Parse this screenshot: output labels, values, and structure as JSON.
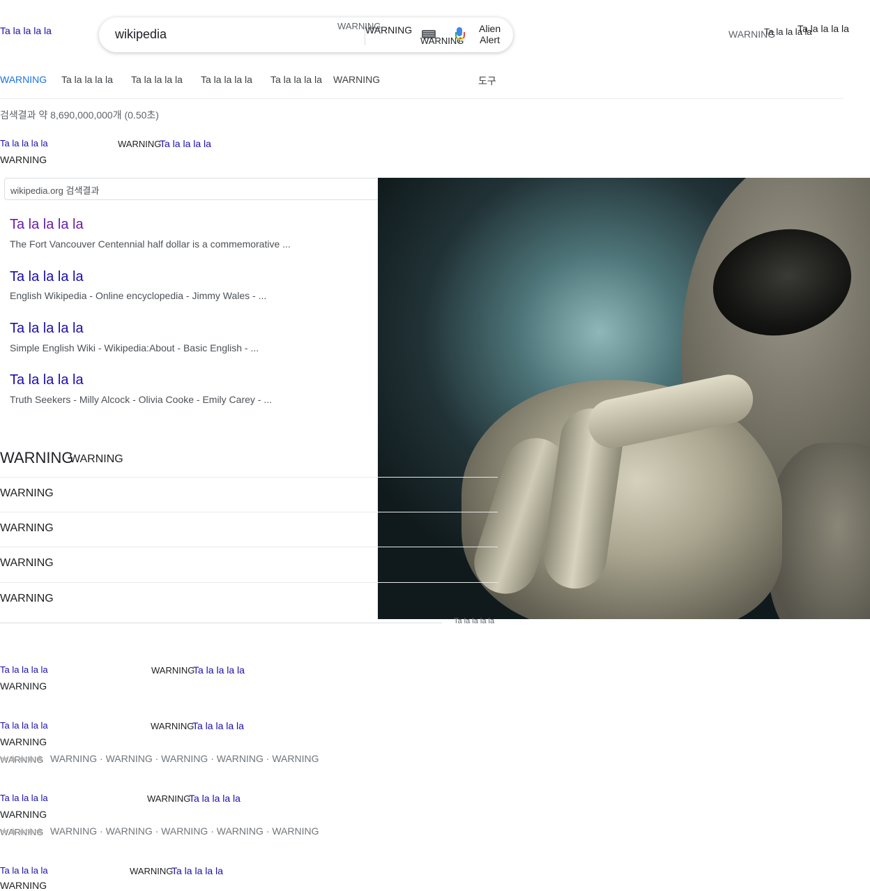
{
  "header": {
    "logo_text": "Ta la la la la",
    "search_value": "wikipedia",
    "box_warning_1": "WARNING",
    "box_warning_2": "WARNING",
    "box_warning_3": "WARNING",
    "alien_alert_line1": "Alien",
    "alien_alert_line2": "Alert",
    "right_warning": "WARNING",
    "right_text_1": "Ta la la la la",
    "right_text_2": "Ta la la la la"
  },
  "tabs": [
    "WARNING",
    "Ta la la la la",
    "Ta la la la la",
    "Ta la la la la",
    "Ta la la la la",
    "WARNING"
  ],
  "tools_label": "도구",
  "stats": "검색결과 약 8,690,000,000개 (0.50초)",
  "top_result": {
    "site": "Ta la la la la",
    "label": "WARNING",
    "link": "Ta la la la la",
    "url_line": "WARNING"
  },
  "site_search_placeholder": "wikipedia.org 검색결과",
  "sub_results": [
    {
      "title": "Ta la la la la",
      "desc": "The Fort Vancouver Centennial half dollar is a commemorative ..."
    },
    {
      "title": "Ta la la la la",
      "desc": "English Wikipedia - Online encyclopedia - Jimmy Wales - ..."
    },
    {
      "title": "Ta la la la la",
      "desc": "Simple English Wiki - Wikipedia:About - Basic English - ..."
    },
    {
      "title": "Ta la la la la",
      "desc": "Truth Seekers - Milly Alcock - Olivia Cooke - Emily Carey - ..."
    }
  ],
  "paa": {
    "heading": "WARNING",
    "heading_small": "WARNING",
    "questions": [
      "WARNING",
      "WARNING",
      "WARNING",
      "WARNING"
    ],
    "feedback": "Ta la la la la"
  },
  "results": [
    {
      "site": "Ta la la la la",
      "label": "WARNING",
      "link": "Ta la la la la",
      "url_line": "WARNING"
    },
    {
      "site": "Ta la la la la",
      "label": "WARNING",
      "link": "Ta la la la la",
      "url_line": "WARNING",
      "rating_label": "WARNING",
      "stars": "★★★★★",
      "meta": "WARNING · WARNING · WARNING · WARNING · WARNING"
    },
    {
      "site": "Ta la la la la",
      "label": "WARNING",
      "link": "Ta la la la la",
      "url_line": "WARNING",
      "rating_label": "WARNING",
      "stars": "★★★★★",
      "meta": "WARNING · WARNING · WARNING · WARNING · WARNING"
    },
    {
      "site": "Ta la la la la",
      "label": "WARNING",
      "link": "Ta la la la la",
      "url_line": "WARNING"
    }
  ],
  "colors": {
    "link": "#1a0dab",
    "visited": "#681da8",
    "active_tab": "#1a73e8"
  },
  "icons": [
    "keyboard-icon",
    "microphone-icon",
    "chevron-down-icon"
  ]
}
